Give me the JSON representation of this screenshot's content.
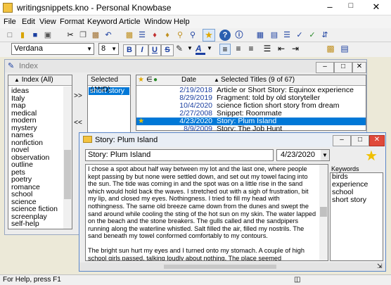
{
  "window": {
    "title": "writingsnippets.kno - Personal Knowbase"
  },
  "menu": [
    "File",
    "Edit",
    "View",
    "Format",
    "Keyword",
    "Article",
    "Window",
    "Help"
  ],
  "format": {
    "font": "Verdana",
    "size": "8",
    "bold": "B",
    "italic": "I",
    "underline": "U",
    "strike": "S",
    "font_color": "A"
  },
  "index_window": {
    "title": "Index",
    "index_header": "Index (All)",
    "index_items": [
      "ideas",
      "Italy",
      "map",
      "medical",
      "modern",
      "mystery",
      "names",
      "nonfiction",
      "novel",
      "observation",
      "outline",
      "pets",
      "poetry",
      "romance",
      "school",
      "science",
      "science fiction",
      "screenplay",
      "self-help"
    ],
    "add_button": ">>",
    "remove_button": "<<",
    "selected_header": "Selected (AND)",
    "selected_items": [
      "short story"
    ],
    "titles_header_date": "Date",
    "titles_header_title": "Selected Titles (9 of 67)",
    "rows": [
      {
        "date": "2/19/2018",
        "title": "Article or Short Story: Equinox experience",
        "star": false,
        "selected": false
      },
      {
        "date": "8/29/2019",
        "title": "Fragment: told by old storyteller",
        "star": false,
        "selected": false
      },
      {
        "date": "10/4/2020",
        "title": "science fiction short story from dream",
        "star": false,
        "selected": false
      },
      {
        "date": "2/27/2008",
        "title": "Snippet: Roommate",
        "star": false,
        "selected": false
      },
      {
        "date": "4/23/2020",
        "title": "Story: Plum Island",
        "star": true,
        "selected": true
      },
      {
        "date": "8/9/2009",
        "title": "Story: The Job Hunt",
        "star": false,
        "selected": false
      }
    ]
  },
  "story_window": {
    "title": "Story: Plum Island",
    "title_field": "Story: Plum Island",
    "date_field": "4/23/2020",
    "keywords_label": "Keywords",
    "keywords": [
      "birds",
      "experience",
      "school",
      "short story"
    ],
    "paragraph1": "I chose a spot about half way between my lot and the last one, where people kept passing by but none were settled down, and set out my towel facing into the sun. The tide was coming in and the spot was on a little rise in the sand which would hold back the waves. I stretched out with a sigh of frustration, bit my lip, and closed my eyes. Nothingness. I tried to fill my head with nothingness. The same old breeze came down from the dunes and swept the sand around while cooling the sting of the hot sun on my skin. The water lapped on the beach and the stone breakers. The gulls called and the sandpipers running along the waterline whistled. Salt filled the air, filled my nostrils. The sand beneath my towel conformed comfortably to my contours.",
    "paragraph2": "The bright sun hurt my eyes and I turned onto my stomach. A couple of high school girls passed, talking loudly about nothing. The place seemed"
  },
  "status": {
    "text": "For Help, press F1"
  }
}
